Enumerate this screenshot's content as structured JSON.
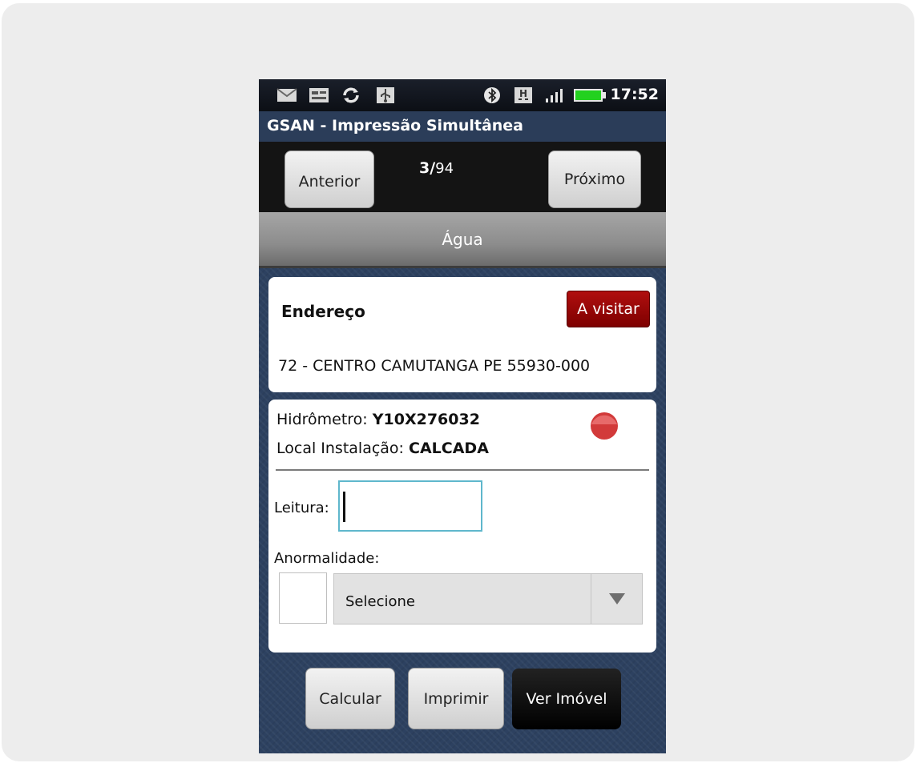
{
  "status_bar": {
    "time": "17:52",
    "icons": [
      "mail-icon",
      "tasks-icon",
      "sync-icon",
      "usb-icon",
      "bluetooth-icon",
      "network-h-icon",
      "signal-icon",
      "battery-icon"
    ]
  },
  "app": {
    "title": "GSAN - Impressão Simultânea"
  },
  "navigation": {
    "prev_label": "Anterior",
    "next_label": "Próximo",
    "current": "3/",
    "total": "94"
  },
  "tab": {
    "label": "Água"
  },
  "address_card": {
    "heading": "Endereço",
    "status_badge": "A visitar",
    "address": "72 - CENTRO CAMUTANGA PE 55930-000"
  },
  "meter_card": {
    "meter_label": "Hidrômetro:",
    "meter_value": "Y10X276032",
    "install_label": "Local Instalação:",
    "install_value": "CALCADA",
    "status_color": "#d23a3a",
    "reading_label": "Leitura:",
    "reading_value": "",
    "anomaly_label": "Anormalidade:",
    "anomaly_selected": "Selecione"
  },
  "actions": {
    "calc_label": "Calcular",
    "print_label": "Imprimir",
    "view_label": "Ver Imóvel"
  }
}
